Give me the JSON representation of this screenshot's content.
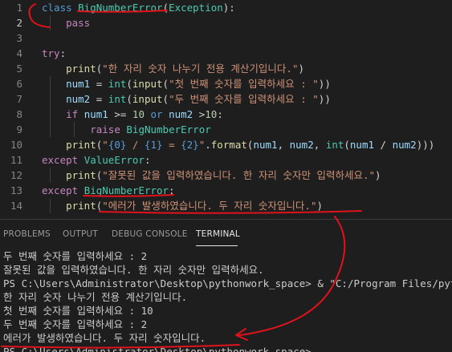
{
  "editor": {
    "lines": [
      {
        "n": "1",
        "tokens": [
          {
            "t": "class ",
            "c": "kwb"
          },
          {
            "t": "BigNumberError",
            "c": "cls"
          },
          {
            "t": "(",
            "c": "plain"
          },
          {
            "t": "Exception",
            "c": "cls"
          },
          {
            "t": "):",
            "c": "plain"
          }
        ]
      },
      {
        "n": "2",
        "tokens": [
          {
            "t": "    ",
            "c": "plain"
          },
          {
            "t": "pass",
            "c": "kw"
          }
        ]
      },
      {
        "n": "3",
        "tokens": []
      },
      {
        "n": "4",
        "tokens": [
          {
            "t": "try",
            "c": "kw"
          },
          {
            "t": ":",
            "c": "plain"
          }
        ]
      },
      {
        "n": "5",
        "tokens": [
          {
            "t": "    ",
            "c": "plain"
          },
          {
            "t": "print",
            "c": "fn"
          },
          {
            "t": "(",
            "c": "plain"
          },
          {
            "t": "\"한 자리 숫자 나누기 전용 계산기입니다.\"",
            "c": "str"
          },
          {
            "t": ")",
            "c": "plain"
          }
        ]
      },
      {
        "n": "6",
        "tokens": [
          {
            "t": "    ",
            "c": "plain"
          },
          {
            "t": "num1",
            "c": "var"
          },
          {
            "t": " = ",
            "c": "plain"
          },
          {
            "t": "int",
            "c": "cls"
          },
          {
            "t": "(",
            "c": "plain"
          },
          {
            "t": "input",
            "c": "fn"
          },
          {
            "t": "(",
            "c": "plain"
          },
          {
            "t": "\"첫 번째 숫자를 입력하세요 : \"",
            "c": "str"
          },
          {
            "t": "))",
            "c": "plain"
          }
        ]
      },
      {
        "n": "7",
        "tokens": [
          {
            "t": "    ",
            "c": "plain"
          },
          {
            "t": "num2",
            "c": "var"
          },
          {
            "t": " = ",
            "c": "plain"
          },
          {
            "t": "int",
            "c": "cls"
          },
          {
            "t": "(",
            "c": "plain"
          },
          {
            "t": "input",
            "c": "fn"
          },
          {
            "t": "(",
            "c": "plain"
          },
          {
            "t": "\"두 번째 숫자를 입력하세요 : \"",
            "c": "str"
          },
          {
            "t": "))",
            "c": "plain"
          }
        ]
      },
      {
        "n": "8",
        "tokens": [
          {
            "t": "    ",
            "c": "plain"
          },
          {
            "t": "if",
            "c": "kw"
          },
          {
            "t": " ",
            "c": "plain"
          },
          {
            "t": "num1",
            "c": "var"
          },
          {
            "t": " >= ",
            "c": "plain"
          },
          {
            "t": "10",
            "c": "num"
          },
          {
            "t": " ",
            "c": "plain"
          },
          {
            "t": "or",
            "c": "kwb"
          },
          {
            "t": " ",
            "c": "plain"
          },
          {
            "t": "num2",
            "c": "var"
          },
          {
            "t": " >",
            "c": "plain"
          },
          {
            "t": "10",
            "c": "num"
          },
          {
            "t": ":",
            "c": "plain"
          }
        ]
      },
      {
        "n": "9",
        "tokens": [
          {
            "t": "        ",
            "c": "plain"
          },
          {
            "t": "raise",
            "c": "kw"
          },
          {
            "t": " ",
            "c": "plain"
          },
          {
            "t": "BigNumberError",
            "c": "cls"
          }
        ]
      },
      {
        "n": "10",
        "tokens": [
          {
            "t": "    ",
            "c": "plain"
          },
          {
            "t": "print",
            "c": "fn"
          },
          {
            "t": "(",
            "c": "plain"
          },
          {
            "t": "\"",
            "c": "str"
          },
          {
            "t": "{0}",
            "c": "fmt"
          },
          {
            "t": " / ",
            "c": "str"
          },
          {
            "t": "{1}",
            "c": "fmt"
          },
          {
            "t": " = ",
            "c": "str"
          },
          {
            "t": "{2}",
            "c": "fmt"
          },
          {
            "t": "\"",
            "c": "str"
          },
          {
            "t": ".",
            "c": "plain"
          },
          {
            "t": "format",
            "c": "fn"
          },
          {
            "t": "(",
            "c": "plain"
          },
          {
            "t": "num1",
            "c": "var"
          },
          {
            "t": ", ",
            "c": "plain"
          },
          {
            "t": "num2",
            "c": "var"
          },
          {
            "t": ", ",
            "c": "plain"
          },
          {
            "t": "int",
            "c": "cls"
          },
          {
            "t": "(",
            "c": "plain"
          },
          {
            "t": "num1",
            "c": "var"
          },
          {
            "t": " / ",
            "c": "plain"
          },
          {
            "t": "num2",
            "c": "var"
          },
          {
            "t": ")))",
            "c": "plain"
          }
        ]
      },
      {
        "n": "11",
        "tokens": [
          {
            "t": "except",
            "c": "kw"
          },
          {
            "t": " ",
            "c": "plain"
          },
          {
            "t": "ValueError",
            "c": "cls"
          },
          {
            "t": ":",
            "c": "plain"
          }
        ]
      },
      {
        "n": "12",
        "tokens": [
          {
            "t": "    ",
            "c": "plain"
          },
          {
            "t": "print",
            "c": "fn"
          },
          {
            "t": "(",
            "c": "plain"
          },
          {
            "t": "\"잘못된 값을 입력하였습니다. 한 자리 숫자만 입력하세요.\"",
            "c": "str"
          },
          {
            "t": ")",
            "c": "plain"
          }
        ]
      },
      {
        "n": "13",
        "tokens": [
          {
            "t": "except",
            "c": "kw"
          },
          {
            "t": " ",
            "c": "plain"
          },
          {
            "t": "BigNumberError",
            "c": "cls"
          },
          {
            "t": ":",
            "c": "plain"
          }
        ]
      },
      {
        "n": "14",
        "tokens": [
          {
            "t": "    ",
            "c": "plain"
          },
          {
            "t": "print",
            "c": "fn"
          },
          {
            "t": "(",
            "c": "plain"
          },
          {
            "t": "\"에러가 발생하였습니다. 두 자리 숫자입니다.\"",
            "c": "str"
          },
          {
            "t": ")",
            "c": "plain"
          }
        ]
      }
    ]
  },
  "panel": {
    "tabs": [
      {
        "label": "PROBLEMS",
        "active": false
      },
      {
        "label": "OUTPUT",
        "active": false
      },
      {
        "label": "DEBUG CONSOLE",
        "active": false
      },
      {
        "label": "TERMINAL",
        "active": true
      }
    ],
    "terminal_lines": [
      "두 번째 숫자를 입력하세요 : 2",
      "잘못된 값을 입력하였습니다. 한 자리 숫자만 입력하세요.",
      "PS C:\\Users\\Administrator\\Desktop\\pythonwork_space> & \"C:/Program Files/python.e",
      "한 자리 숫자 나누기 전용 계산기입니다.",
      "첫 번째 숫자를 입력하세요 : 10",
      "두 번째 숫자를 입력하세요 : 2",
      "에러가 발생하였습니다. 두 자리 숫자입니다.",
      "PS C:\\Users\\Administrator\\Desktop\\pythonwork_space>"
    ]
  },
  "annotation": {
    "color": "#e0121b"
  }
}
